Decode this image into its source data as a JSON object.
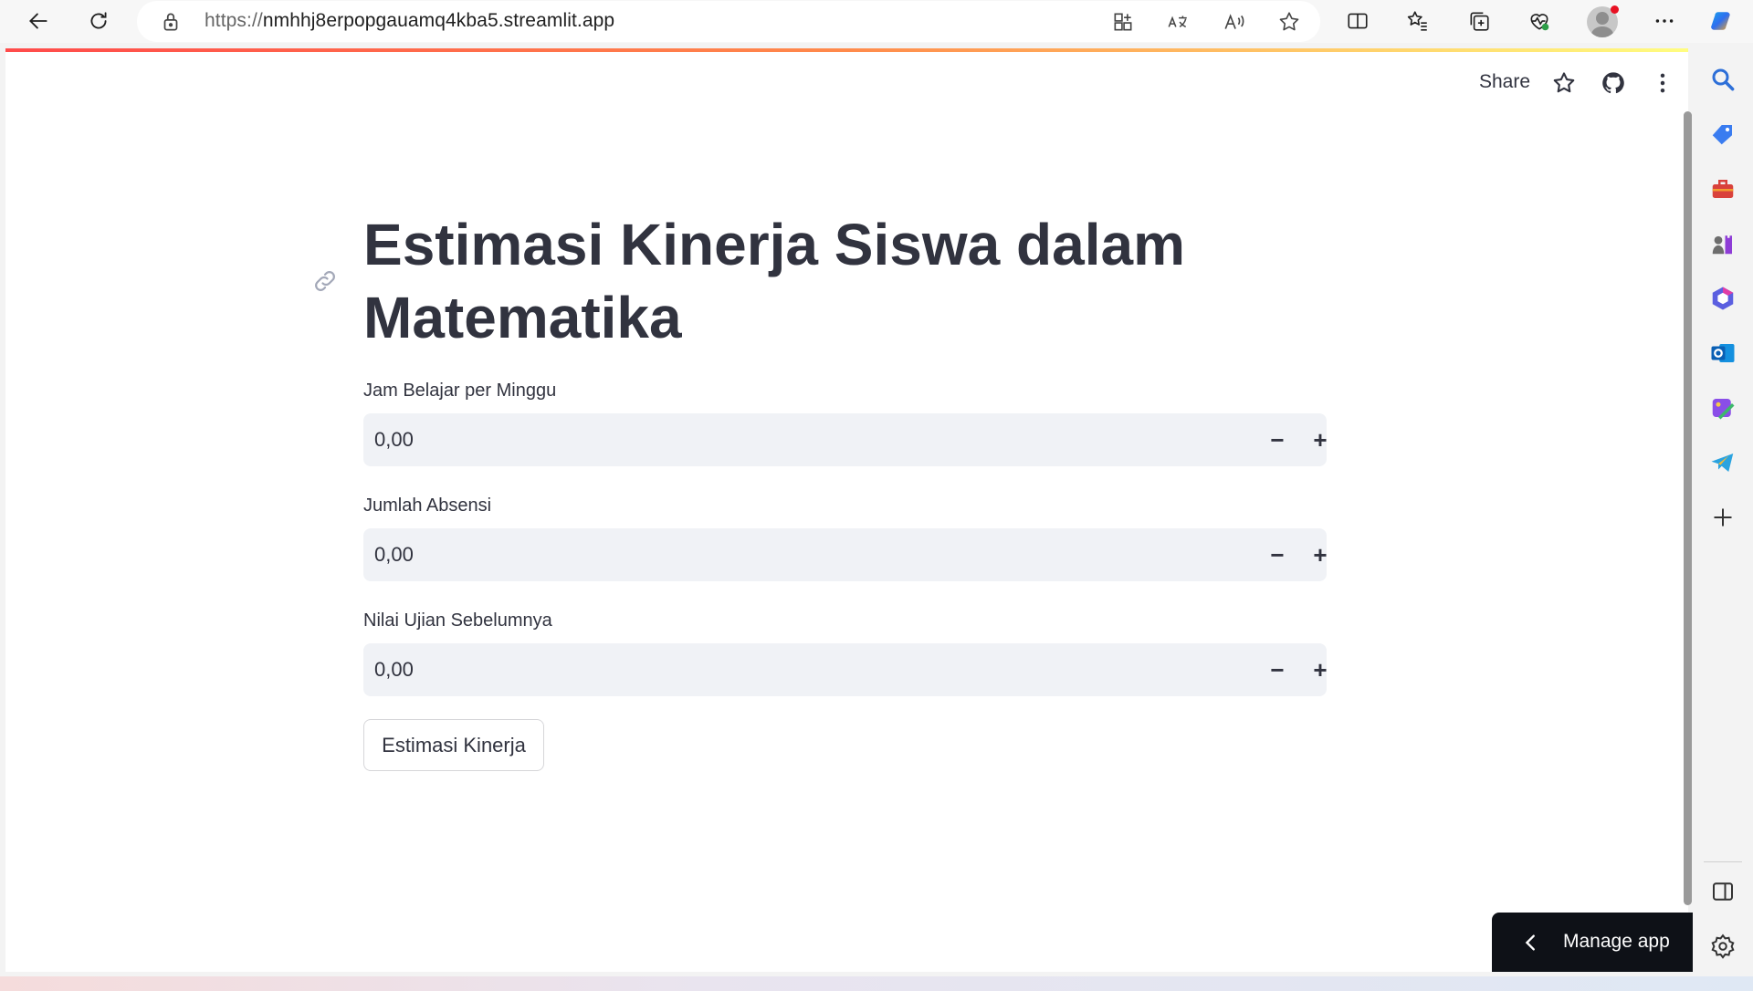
{
  "browser": {
    "url_protocol": "https://",
    "url_host": "nmhhj8erpopgauamq4kba5.streamlit.app",
    "toolbar_icons": [
      "back-icon",
      "refresh-icon",
      "lock-icon",
      "app-available-icon",
      "translate-icon",
      "read-aloud-icon",
      "favorite-star-icon",
      "split-screen-icon",
      "favorites-icon",
      "collections-icon",
      "browser-essentials-icon",
      "profile-avatar",
      "more-icon",
      "copilot-icon"
    ]
  },
  "app_header": {
    "share_label": "Share",
    "icons": [
      "star-icon",
      "github-icon",
      "kebab-menu-icon"
    ]
  },
  "main": {
    "title": "Estimasi Kinerja Siswa dalam Matematika",
    "inputs": [
      {
        "label": "Jam Belajar per Minggu",
        "value": "0,00",
        "minus": "−",
        "plus": "+"
      },
      {
        "label": "Jumlah Absensi",
        "value": "0,00",
        "minus": "−",
        "plus": "+"
      },
      {
        "label": "Nilai Ujian Sebelumnya",
        "value": "0,00",
        "minus": "−",
        "plus": "+"
      }
    ],
    "submit_label": "Estimasi Kinerja"
  },
  "manage_app": {
    "label": "Manage app"
  },
  "edge_sidebar": {
    "icons": [
      "search-icon",
      "shopping-tag-icon",
      "tools-icon",
      "games-icon",
      "microsoft-365-icon",
      "outlook-icon",
      "designer-icon",
      "telegram-icon",
      "add-icon",
      "sidebar-toggle-icon",
      "settings-icon"
    ]
  },
  "colors": {
    "accent": "#ff4b4b",
    "text": "#31333f",
    "input_bg": "#f0f2f6",
    "manage_bg": "#0e1117"
  }
}
